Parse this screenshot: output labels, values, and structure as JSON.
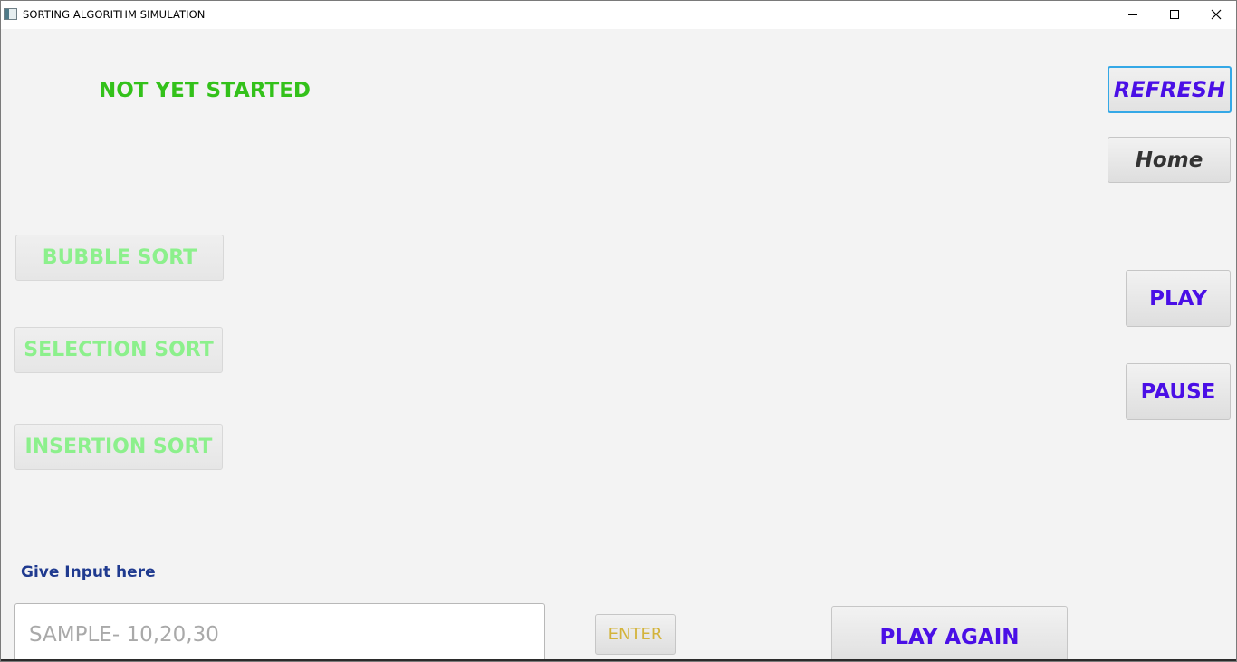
{
  "window": {
    "title": "SORTING ALGORITHM SIMULATION",
    "controls": [
      "minimize-icon",
      "maximize-icon",
      "close-icon"
    ]
  },
  "status": {
    "text": "NOT YET STARTED",
    "color": "#33c11a"
  },
  "buttons": {
    "refresh": "REFRESH",
    "home": "Home",
    "play": "PLAY",
    "pause": "PAUSE",
    "enter": "ENTER",
    "play_again": "PLAY AGAIN"
  },
  "algorithms": [
    {
      "label": "BUBBLE SORT"
    },
    {
      "label": "SELECTION SORT"
    },
    {
      "label": "INSERTION SORT"
    }
  ],
  "input": {
    "label": "Give Input here",
    "placeholder": "SAMPLE- 10,20,30",
    "value": ""
  },
  "colors": {
    "accent": "#4a0fe6",
    "algo_disabled": "#8cf08c",
    "focus_border": "#34a8e6",
    "label": "#1f3a8f",
    "enter": "#d3b33a"
  }
}
